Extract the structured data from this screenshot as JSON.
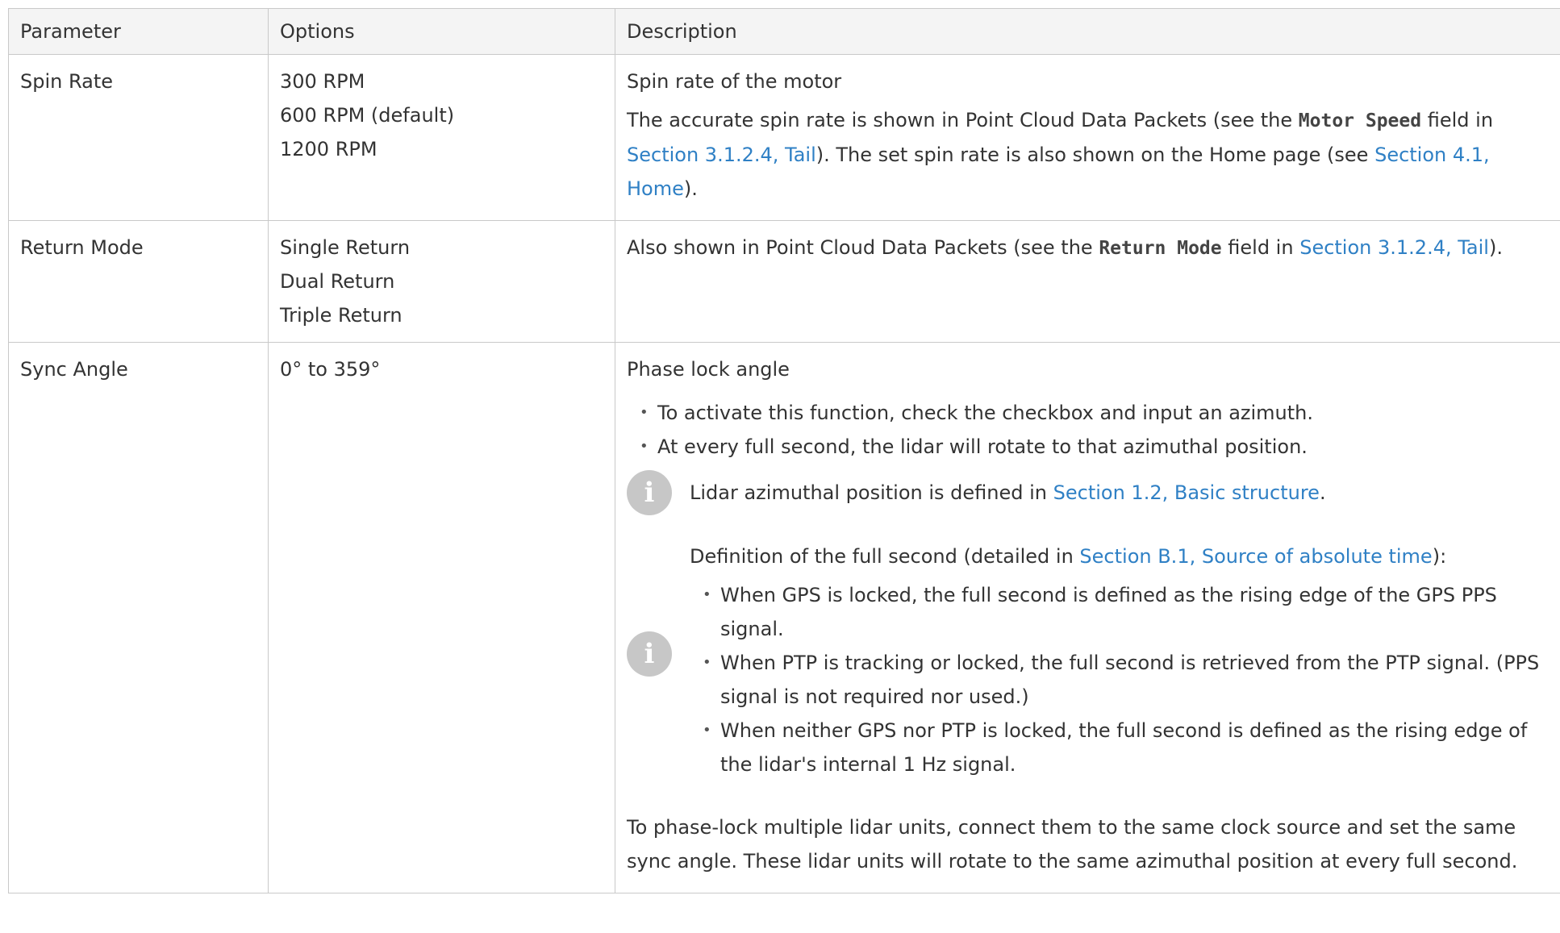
{
  "headers": {
    "parameter": "Parameter",
    "options": "Options",
    "description": "Description"
  },
  "rows": [
    {
      "parameter": "Spin Rate",
      "options": [
        "300 RPM",
        "600 RPM (default)",
        "1200 RPM"
      ],
      "desc_title": "Spin rate of the motor",
      "p1": "The accurate spin rate is shown in Point Cloud Data Packets (see the ",
      "code": "Motor Speed",
      "p2": " field in ",
      "link1": "Section 3.1.2.4, Tail",
      "p3": "). The set spin rate is also shown on the Home page (see ",
      "link2": "Section 4.1, Home",
      "p4": ")."
    },
    {
      "parameter": "Return Mode",
      "options": [
        "Single Return",
        "Dual Return",
        "Triple Return"
      ],
      "p1": "Also shown in Point Cloud Data Packets (see the ",
      "code": "Return Mode",
      "p2": " field in ",
      "link1": "Section 3.1.2.4, Tail",
      "p3": ")."
    },
    {
      "parameter": "Sync Angle",
      "options": [
        "0° to 359°"
      ],
      "desc_title": "Phase lock angle",
      "bullets": [
        "To activate this function, check the checkbox and input an azimuth.",
        "At every full second, the lidar will rotate to that azimuthal position."
      ],
      "note1": {
        "icon": "i",
        "text": "Lidar azimuthal position is defined in ",
        "link": "Section 1.2, Basic structure",
        "end": "."
      },
      "note2": {
        "icon": "i",
        "intro": "Definition of the full second (detailed in ",
        "link": "Section B.1, Source of absolute time",
        "intro_end": "):",
        "bullets": [
          "When GPS is locked, the full second is defined as the rising edge of the GPS PPS signal.",
          "When PTP is tracking or locked, the full second is retrieved from the PTP signal. (PPS signal is not required nor used.)",
          "When neither GPS nor PTP is locked, the full second is defined as the rising edge of the lidar's internal 1 Hz signal."
        ]
      },
      "closing": "To phase-lock multiple lidar units, connect them to the same clock source and set the same sync angle. These lidar units will rotate to the same azimuthal position at every full second."
    }
  ],
  "colors": {
    "link": "#2f80c5",
    "header_bg": "#f4f4f4",
    "border": "#c9c9c9",
    "icon_bg": "#c7c7c7"
  }
}
